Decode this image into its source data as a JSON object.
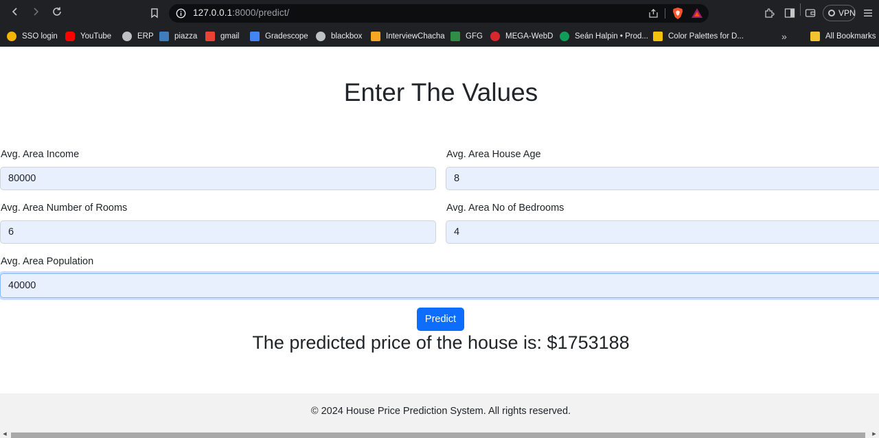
{
  "browser": {
    "url_host": "127.0.0.1",
    "url_rest": ":8000/predict/",
    "vpn_label": "VPN",
    "bookmarks": [
      {
        "label": "SSO login",
        "icon": "sso-icon",
        "color": "#f4b400"
      },
      {
        "label": "YouTube",
        "icon": "youtube-icon",
        "color": "#ff0000"
      },
      {
        "label": "ERP",
        "icon": "globe-icon",
        "color": "#bdc1c6"
      },
      {
        "label": "piazza",
        "icon": "piazza-icon",
        "color": "#3e7ebe"
      },
      {
        "label": "gmail",
        "icon": "gmail-icon",
        "color": "#ea4335"
      },
      {
        "label": "Gradescope",
        "icon": "gradescope-icon",
        "color": "#4285f4"
      },
      {
        "label": "blackbox",
        "icon": "blackbox-icon",
        "color": "#bdc1c6"
      },
      {
        "label": "InterviewChacha",
        "icon": "interviewchacha-icon",
        "color": "#f5a623"
      },
      {
        "label": "GFG",
        "icon": "gfg-icon",
        "color": "#2f8d46"
      },
      {
        "label": "MEGA-WebD",
        "icon": "mega-icon",
        "color": "#d9272e"
      },
      {
        "label": "Seán Halpin • Prod...",
        "icon": "seanhalpin-icon",
        "color": "#0f9d58"
      },
      {
        "label": "Color Palettes for D...",
        "icon": "palette-icon",
        "color": "#f4c20d"
      }
    ],
    "all_bookmarks_label": "All Bookmarks"
  },
  "page": {
    "title": "Enter The Values",
    "fields": {
      "income": {
        "label": "Avg. Area Income",
        "value": "80000"
      },
      "house_age": {
        "label": "Avg. Area House Age",
        "value": "8"
      },
      "rooms": {
        "label": "Avg. Area Number of Rooms",
        "value": "6"
      },
      "bedrooms": {
        "label": "Avg. Area No of Bedrooms",
        "value": "4"
      },
      "population": {
        "label": "Avg. Area Population",
        "value": "40000"
      }
    },
    "predict_label": "Predict",
    "result_text": "The predicted price of the house is: $1753188",
    "footer_text": "© 2024 House Price Prediction System. All rights reserved."
  },
  "colors": {
    "chrome_bg": "#202124",
    "primary_button": "#0d6efd",
    "input_bg": "#e8f0fe",
    "footer_bg": "#f2f2f2"
  }
}
